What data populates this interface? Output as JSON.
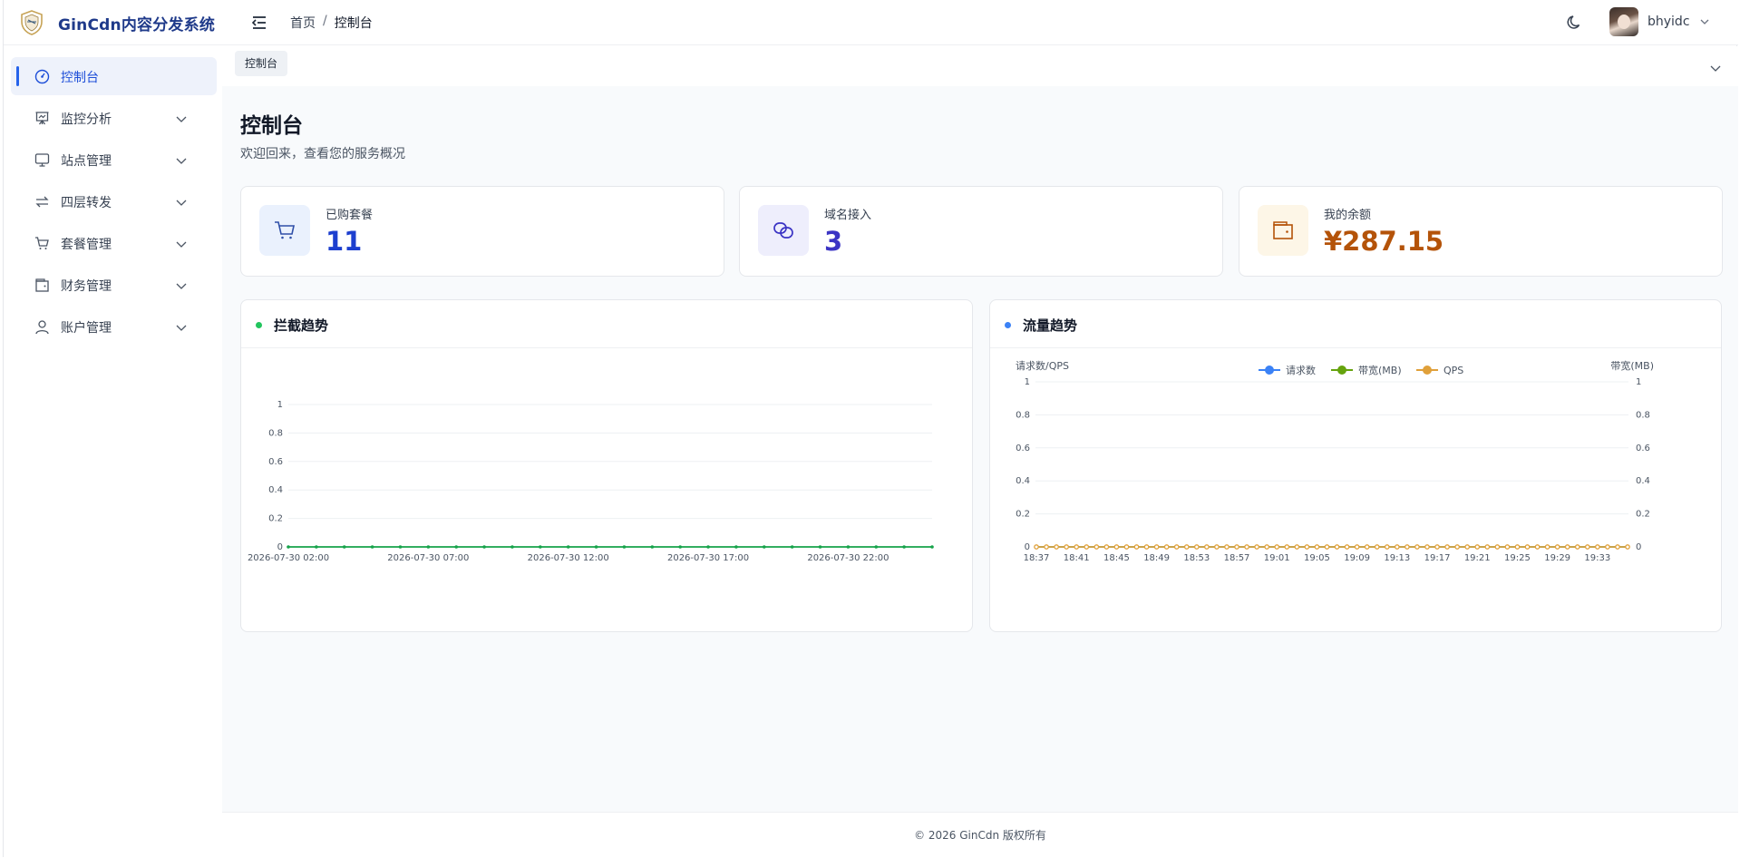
{
  "app": {
    "title": "GinCdn内容分发系统"
  },
  "header": {
    "breadcrumb": [
      "首页",
      "控制台"
    ],
    "breadcrumb_sep": "/",
    "username": "bhyidc"
  },
  "sidebar": {
    "items": [
      {
        "label": "控制台",
        "icon": "dashboard-icon",
        "active": true
      },
      {
        "label": "监控分析",
        "icon": "monitor-board-icon"
      },
      {
        "label": "站点管理",
        "icon": "desktop-icon"
      },
      {
        "label": "四层转发",
        "icon": "forward-arrows-icon"
      },
      {
        "label": "套餐管理",
        "icon": "cart-icon"
      },
      {
        "label": "财务管理",
        "icon": "wallet-icon"
      },
      {
        "label": "账户管理",
        "icon": "user-icon"
      }
    ]
  },
  "tags": {
    "active": "控制台"
  },
  "page": {
    "title": "控制台",
    "subtitle": "欢迎回来，查看您的服务概况"
  },
  "stats": [
    {
      "label": "已购套餐",
      "value": "11",
      "icon": "cart-icon",
      "color": "#1d3fcf",
      "bg": "#eaf1fd"
    },
    {
      "label": "域名接入",
      "value": "3",
      "icon": "link-icon",
      "color": "#3b34c4",
      "bg": "#eeeefc"
    },
    {
      "label": "我的余额",
      "value": "¥287.15",
      "icon": "wallet-icon",
      "color": "#b45309",
      "bg": "#fdf6e7"
    }
  ],
  "panels": {
    "block": {
      "title": "拦截趋势",
      "dot_color": "#22c55e"
    },
    "traffic": {
      "title": "流量趋势",
      "dot_color": "#3b82f6"
    }
  },
  "footer": {
    "text": "© 2026 GinCdn 版权所有"
  },
  "chart_data": [
    {
      "type": "line",
      "ylim": [
        0,
        1
      ],
      "y_ticks": [
        "0",
        "0.2",
        "0.4",
        "0.6",
        "0.8",
        "1"
      ],
      "x_tick_labels": [
        "2026-07-30 02:00",
        "2026-07-30 07:00",
        "2026-07-30 12:00",
        "2026-07-30 17:00",
        "2026-07-30 22:00"
      ],
      "point_count": 24,
      "series": [
        {
          "color": "#16a34a",
          "values": [
            0,
            0,
            0,
            0,
            0,
            0,
            0,
            0,
            0,
            0,
            0,
            0,
            0,
            0,
            0,
            0,
            0,
            0,
            0,
            0,
            0,
            0,
            0,
            0
          ]
        }
      ]
    },
    {
      "type": "line",
      "ylabel": "请求数/QPS",
      "y2label": "带宽(MB)",
      "ylim": [
        0,
        1
      ],
      "y2lim": [
        0,
        1
      ],
      "y_ticks": [
        "0",
        "0.2",
        "0.4",
        "0.6",
        "0.8",
        "1"
      ],
      "x_tick_labels": [
        "18:37",
        "18:41",
        "18:45",
        "18:49",
        "18:53",
        "18:57",
        "19:01",
        "19:05",
        "19:09",
        "19:13",
        "19:17",
        "19:21",
        "19:25",
        "19:29",
        "19:33"
      ],
      "point_count": 60,
      "legend": [
        {
          "name": "请求数",
          "color": "#3b82f6"
        },
        {
          "name": "带宽(MB)",
          "color": "#65a30d"
        },
        {
          "name": "QPS",
          "color": "#e0a03a"
        }
      ],
      "series": [
        {
          "name": "请求数",
          "color": "#3b82f6",
          "value": 0
        },
        {
          "name": "带宽(MB)",
          "color": "#65a30d",
          "value": 0
        },
        {
          "name": "QPS",
          "color": "#e0a03a",
          "value": 0
        }
      ]
    }
  ]
}
